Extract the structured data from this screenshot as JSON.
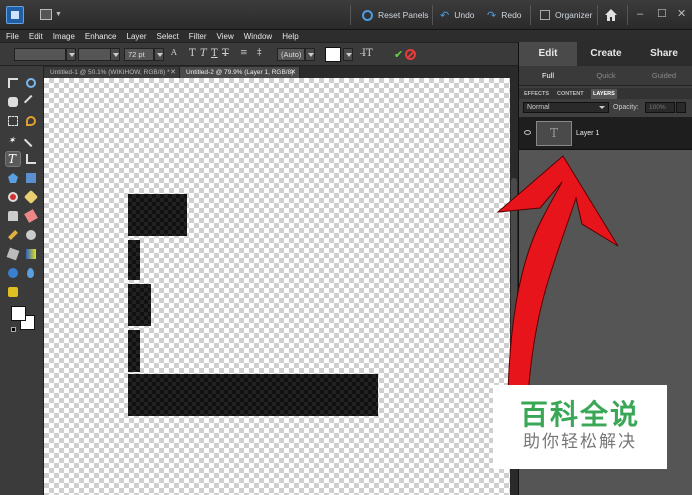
{
  "titlebar": {
    "reset_panels": "Reset Panels",
    "undo": "Undo",
    "redo": "Redo",
    "organizer": "Organizer"
  },
  "menu": [
    "File",
    "Edit",
    "Image",
    "Enhance",
    "Layer",
    "Select",
    "Filter",
    "View",
    "Window",
    "Help"
  ],
  "options": {
    "font_size": "72 pt",
    "leading": "(Auto)"
  },
  "tabs": [
    {
      "label": "Untitled-1 @ 50.1% (WIKIHOW, RGB/8) *"
    },
    {
      "label": "Untitled-2 @ 79.9% (Layer 1, RGB/8)"
    }
  ],
  "panel": {
    "modes": [
      "Edit",
      "Create",
      "Share"
    ],
    "submodes": [
      "Full",
      "Quick",
      "Guided"
    ],
    "panel_tabs": [
      "EFFECTS",
      "CONTENT",
      "LAYERS"
    ],
    "blend_mode": "Normal",
    "opacity_label": "Opacity:",
    "opacity_value": "100%",
    "layer_name": "Layer 1",
    "layer_thumb": "T"
  },
  "watermark": {
    "title": "百科全说",
    "subtitle": "助你轻松解决"
  },
  "colors": {
    "annotation_arrow": "#e8141b",
    "watermark_green": "#3aa757",
    "accent_blue": "#4d9be0"
  }
}
